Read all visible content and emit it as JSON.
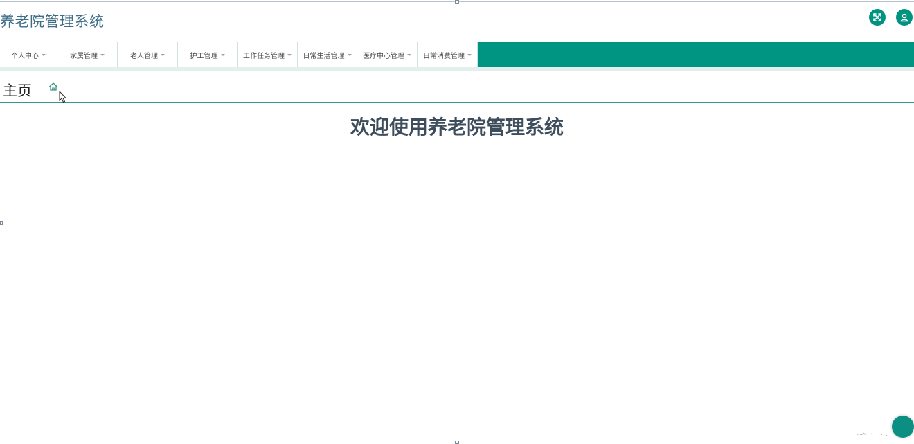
{
  "app": {
    "title": "养老院管理系统"
  },
  "header": {
    "fullscreen_icon": "fullscreen-toggle-icon",
    "user_icon": "user-avatar-icon"
  },
  "nav": {
    "items": [
      {
        "label": "个人中心"
      },
      {
        "label": "家属管理"
      },
      {
        "label": "老人管理"
      },
      {
        "label": "护工管理"
      },
      {
        "label": "工作任务管理"
      },
      {
        "label": "日常生活管理"
      },
      {
        "label": "医疗中心管理"
      },
      {
        "label": "日常消费管理"
      }
    ]
  },
  "breadcrumb": {
    "title": "主页",
    "icon": "home-icon"
  },
  "main": {
    "welcome": "欢迎使用养老院管理系统"
  },
  "colors": {
    "primary": "#009483",
    "title_text": "#3e6d87",
    "welcome_text": "#3d4d5c"
  }
}
